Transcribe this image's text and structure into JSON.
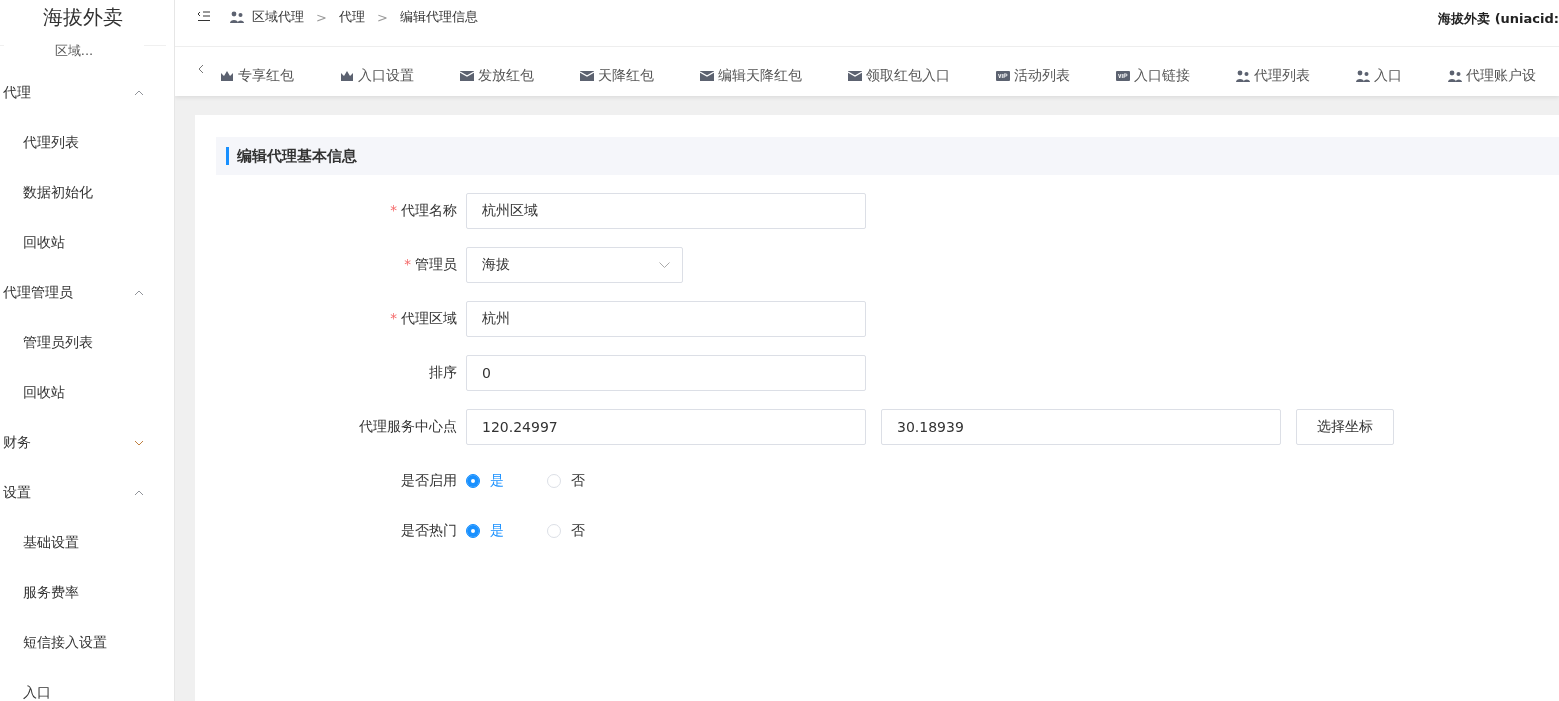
{
  "sidebar": {
    "title": "海拔外卖",
    "subtitle": "区域...",
    "groups": [
      {
        "label": "代理",
        "expanded": true,
        "children": [
          {
            "label": "代理列表"
          },
          {
            "label": "数据初始化"
          },
          {
            "label": "回收站"
          }
        ]
      },
      {
        "label": "代理管理员",
        "expanded": true,
        "children": [
          {
            "label": "管理员列表"
          },
          {
            "label": "回收站"
          }
        ]
      },
      {
        "label": "财务",
        "expanded": false
      },
      {
        "label": "设置",
        "expanded": true,
        "children": [
          {
            "label": "基础设置"
          },
          {
            "label": "服务费率"
          },
          {
            "label": "短信接入设置"
          },
          {
            "label": "入口"
          }
        ]
      }
    ]
  },
  "header": {
    "breadcrumb": [
      {
        "label": "区域代理"
      },
      {
        "separator": ">",
        "label": "代理"
      },
      {
        "separator": ">",
        "label": "编辑代理信息"
      }
    ],
    "account": "海拔外卖 (uniacid:"
  },
  "tabs": [
    {
      "label": "专享红包",
      "kind": "crown"
    },
    {
      "label": "入口设置",
      "kind": "crown"
    },
    {
      "label": "发放红包",
      "kind": "envelope"
    },
    {
      "label": "天降红包",
      "kind": "envelope"
    },
    {
      "label": "编辑天降红包",
      "kind": "envelope"
    },
    {
      "label": "领取红包入口",
      "kind": "envelope"
    },
    {
      "label": "活动列表",
      "kind": "vip"
    },
    {
      "label": "入口链接",
      "kind": "vip"
    },
    {
      "label": "代理列表",
      "kind": "users"
    },
    {
      "label": "入口",
      "kind": "users"
    },
    {
      "label": "代理账户设",
      "kind": "users"
    }
  ],
  "form": {
    "title": "编辑代理基本信息",
    "fields": [
      {
        "kind": "text",
        "required_mark": "*",
        "label": "代理名称",
        "value": "杭州区域"
      },
      {
        "kind": "select",
        "required_mark": "*",
        "label": "管理员",
        "value": "海拔"
      },
      {
        "kind": "text",
        "required_mark": "*",
        "label": "代理区域",
        "value": "杭州"
      },
      {
        "kind": "text",
        "label": "排序",
        "value": "0"
      },
      {
        "kind": "coords",
        "label": "代理服务中心点",
        "values": [
          "120.24997",
          "30.18939"
        ],
        "button": "选择坐标"
      },
      {
        "kind": "radio",
        "label": "是否启用",
        "options": [
          {
            "label": "是",
            "selected": true
          },
          {
            "label": "否",
            "selected": false
          }
        ]
      },
      {
        "kind": "radio",
        "label": "是否热门",
        "options": [
          {
            "label": "是",
            "selected": true
          },
          {
            "label": "否",
            "selected": false
          }
        ]
      }
    ]
  }
}
